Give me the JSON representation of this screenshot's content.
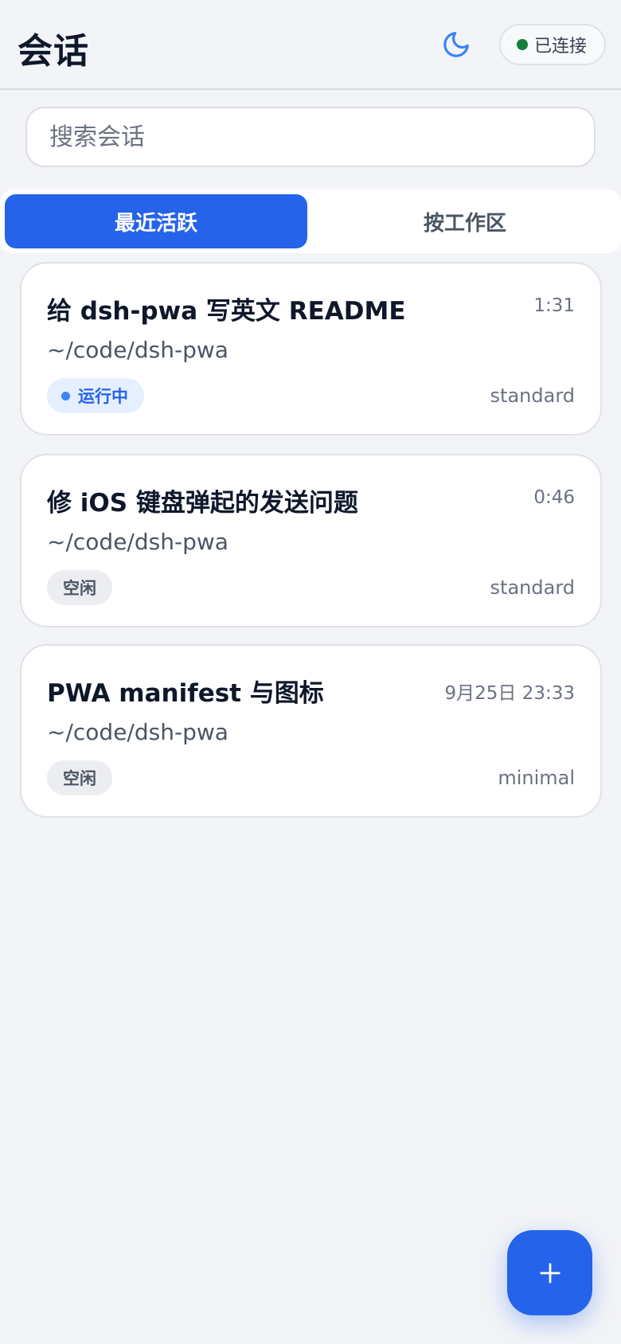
{
  "header": {
    "title": "会话",
    "theme_icon": "moon-icon",
    "connection": {
      "label": "已连接",
      "status_color": "#15803d"
    }
  },
  "search": {
    "value": "",
    "placeholder": "搜索会话"
  },
  "tabs": [
    {
      "label": "最近活跃",
      "active": true
    },
    {
      "label": "按工作区",
      "active": false
    }
  ],
  "sessions": [
    {
      "title": "给 dsh-pwa 写英文 README",
      "time": "1:31",
      "path": "~/code/dsh-pwa",
      "status": "运行中",
      "mode": "standard"
    },
    {
      "title": "修 iOS 键盘弹起的发送问题",
      "time": "0:46",
      "path": "~/code/dsh-pwa",
      "status": "空闲",
      "mode": "standard"
    },
    {
      "title": "PWA manifest 与图标",
      "time": "9月25日 23:33",
      "path": "~/code/dsh-pwa",
      "status": "空闲",
      "mode": "minimal"
    }
  ],
  "fab": {
    "icon": "plus-icon"
  },
  "colors": {
    "accent": "#2563eb",
    "background": "#f3f4f7",
    "running_badge_bg": "#e6efff",
    "idle_badge_bg": "#ebedf0"
  }
}
